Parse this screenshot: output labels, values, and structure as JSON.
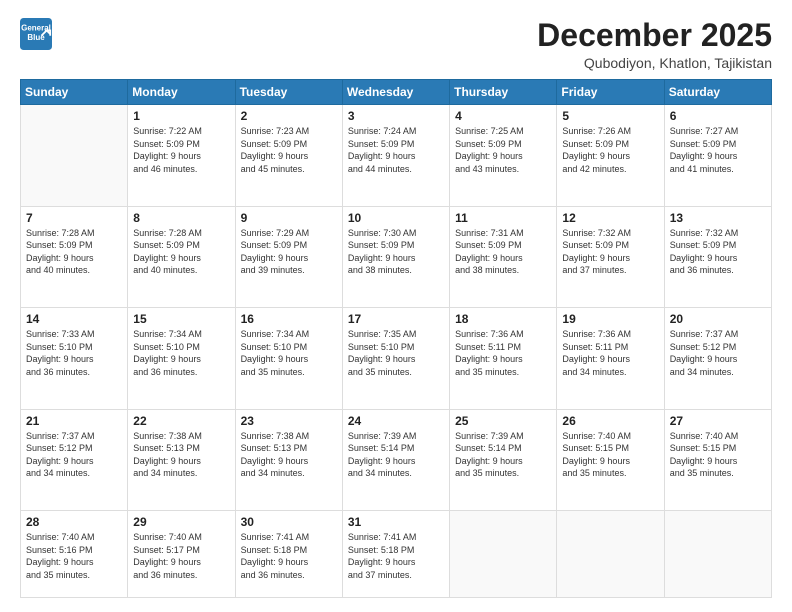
{
  "logo": {
    "line1": "General",
    "line2": "Blue"
  },
  "title": "December 2025",
  "location": "Qubodiyon, Khatlon, Tajikistan",
  "days_of_week": [
    "Sunday",
    "Monday",
    "Tuesday",
    "Wednesday",
    "Thursday",
    "Friday",
    "Saturday"
  ],
  "weeks": [
    [
      {
        "day": "",
        "info": ""
      },
      {
        "day": "1",
        "info": "Sunrise: 7:22 AM\nSunset: 5:09 PM\nDaylight: 9 hours\nand 46 minutes."
      },
      {
        "day": "2",
        "info": "Sunrise: 7:23 AM\nSunset: 5:09 PM\nDaylight: 9 hours\nand 45 minutes."
      },
      {
        "day": "3",
        "info": "Sunrise: 7:24 AM\nSunset: 5:09 PM\nDaylight: 9 hours\nand 44 minutes."
      },
      {
        "day": "4",
        "info": "Sunrise: 7:25 AM\nSunset: 5:09 PM\nDaylight: 9 hours\nand 43 minutes."
      },
      {
        "day": "5",
        "info": "Sunrise: 7:26 AM\nSunset: 5:09 PM\nDaylight: 9 hours\nand 42 minutes."
      },
      {
        "day": "6",
        "info": "Sunrise: 7:27 AM\nSunset: 5:09 PM\nDaylight: 9 hours\nand 41 minutes."
      }
    ],
    [
      {
        "day": "7",
        "info": "Sunrise: 7:28 AM\nSunset: 5:09 PM\nDaylight: 9 hours\nand 40 minutes."
      },
      {
        "day": "8",
        "info": "Sunrise: 7:28 AM\nSunset: 5:09 PM\nDaylight: 9 hours\nand 40 minutes."
      },
      {
        "day": "9",
        "info": "Sunrise: 7:29 AM\nSunset: 5:09 PM\nDaylight: 9 hours\nand 39 minutes."
      },
      {
        "day": "10",
        "info": "Sunrise: 7:30 AM\nSunset: 5:09 PM\nDaylight: 9 hours\nand 38 minutes."
      },
      {
        "day": "11",
        "info": "Sunrise: 7:31 AM\nSunset: 5:09 PM\nDaylight: 9 hours\nand 38 minutes."
      },
      {
        "day": "12",
        "info": "Sunrise: 7:32 AM\nSunset: 5:09 PM\nDaylight: 9 hours\nand 37 minutes."
      },
      {
        "day": "13",
        "info": "Sunrise: 7:32 AM\nSunset: 5:09 PM\nDaylight: 9 hours\nand 36 minutes."
      }
    ],
    [
      {
        "day": "14",
        "info": "Sunrise: 7:33 AM\nSunset: 5:10 PM\nDaylight: 9 hours\nand 36 minutes."
      },
      {
        "day": "15",
        "info": "Sunrise: 7:34 AM\nSunset: 5:10 PM\nDaylight: 9 hours\nand 36 minutes."
      },
      {
        "day": "16",
        "info": "Sunrise: 7:34 AM\nSunset: 5:10 PM\nDaylight: 9 hours\nand 35 minutes."
      },
      {
        "day": "17",
        "info": "Sunrise: 7:35 AM\nSunset: 5:10 PM\nDaylight: 9 hours\nand 35 minutes."
      },
      {
        "day": "18",
        "info": "Sunrise: 7:36 AM\nSunset: 5:11 PM\nDaylight: 9 hours\nand 35 minutes."
      },
      {
        "day": "19",
        "info": "Sunrise: 7:36 AM\nSunset: 5:11 PM\nDaylight: 9 hours\nand 34 minutes."
      },
      {
        "day": "20",
        "info": "Sunrise: 7:37 AM\nSunset: 5:12 PM\nDaylight: 9 hours\nand 34 minutes."
      }
    ],
    [
      {
        "day": "21",
        "info": "Sunrise: 7:37 AM\nSunset: 5:12 PM\nDaylight: 9 hours\nand 34 minutes."
      },
      {
        "day": "22",
        "info": "Sunrise: 7:38 AM\nSunset: 5:13 PM\nDaylight: 9 hours\nand 34 minutes."
      },
      {
        "day": "23",
        "info": "Sunrise: 7:38 AM\nSunset: 5:13 PM\nDaylight: 9 hours\nand 34 minutes."
      },
      {
        "day": "24",
        "info": "Sunrise: 7:39 AM\nSunset: 5:14 PM\nDaylight: 9 hours\nand 34 minutes."
      },
      {
        "day": "25",
        "info": "Sunrise: 7:39 AM\nSunset: 5:14 PM\nDaylight: 9 hours\nand 35 minutes."
      },
      {
        "day": "26",
        "info": "Sunrise: 7:40 AM\nSunset: 5:15 PM\nDaylight: 9 hours\nand 35 minutes."
      },
      {
        "day": "27",
        "info": "Sunrise: 7:40 AM\nSunset: 5:15 PM\nDaylight: 9 hours\nand 35 minutes."
      }
    ],
    [
      {
        "day": "28",
        "info": "Sunrise: 7:40 AM\nSunset: 5:16 PM\nDaylight: 9 hours\nand 35 minutes."
      },
      {
        "day": "29",
        "info": "Sunrise: 7:40 AM\nSunset: 5:17 PM\nDaylight: 9 hours\nand 36 minutes."
      },
      {
        "day": "30",
        "info": "Sunrise: 7:41 AM\nSunset: 5:18 PM\nDaylight: 9 hours\nand 36 minutes."
      },
      {
        "day": "31",
        "info": "Sunrise: 7:41 AM\nSunset: 5:18 PM\nDaylight: 9 hours\nand 37 minutes."
      },
      {
        "day": "",
        "info": ""
      },
      {
        "day": "",
        "info": ""
      },
      {
        "day": "",
        "info": ""
      }
    ]
  ]
}
